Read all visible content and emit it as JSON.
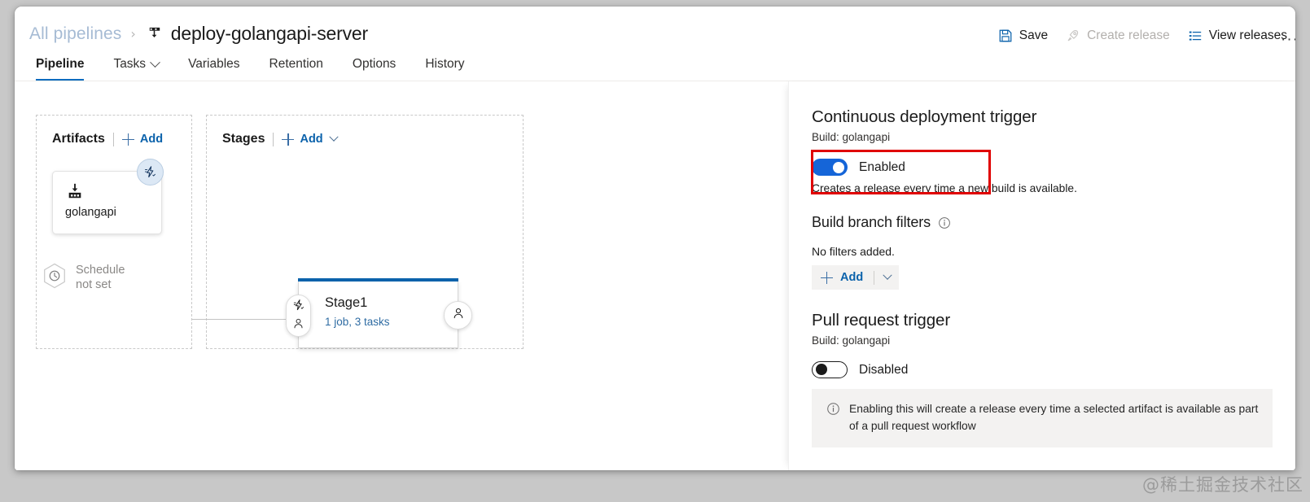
{
  "breadcrumb": {
    "root": "All pipelines",
    "separator": "›",
    "title": "deploy-golangapi-server",
    "icon": "pipeline-icon"
  },
  "toolbar": {
    "items": [
      {
        "label": "Save",
        "icon": "save-icon",
        "disabled": false
      },
      {
        "label": "Create release",
        "icon": "rocket-icon",
        "disabled": true
      },
      {
        "label": "View releases",
        "icon": "list-icon",
        "disabled": false
      }
    ],
    "more_label": "···"
  },
  "tabs": [
    {
      "label": "Pipeline",
      "active": true,
      "caret": false
    },
    {
      "label": "Tasks",
      "active": false,
      "caret": true
    },
    {
      "label": "Variables",
      "active": false,
      "caret": false
    },
    {
      "label": "Retention",
      "active": false,
      "caret": false
    },
    {
      "label": "Options",
      "active": false,
      "caret": false
    },
    {
      "label": "History",
      "active": false,
      "caret": false
    }
  ],
  "canvas": {
    "artifacts": {
      "title": "Artifacts",
      "add_label": "Add",
      "node": {
        "label": "golangapi",
        "icon": "build-artifact-icon",
        "badge_icon": "continuous-deployment-trigger-icon"
      },
      "schedule": {
        "line1": "Schedule",
        "line2": "not set",
        "icon": "clock-icon"
      }
    },
    "stages": {
      "title": "Stages",
      "add_label": "Add",
      "stage": {
        "name": "Stage1",
        "summary": "1 job, 3 tasks",
        "pre_icons": [
          "pre-deployment-trigger-icon",
          "pre-deployment-approval-icon"
        ],
        "post_icon": "post-deployment-approval-icon"
      }
    }
  },
  "details": {
    "cd_trigger": {
      "title": "Continuous deployment trigger",
      "subtitle": "Build: golangapi",
      "toggle_state": "on",
      "toggle_label": "Enabled",
      "helper": "Creates a release every time a new build is available.",
      "highlight_color": "#e00000"
    },
    "branch_filters": {
      "title": "Build branch filters",
      "info_icon": "info-icon",
      "empty_text": "No filters added.",
      "add_label": "Add"
    },
    "pr_trigger": {
      "title": "Pull request trigger",
      "subtitle": "Build: golangapi",
      "toggle_state": "off",
      "toggle_label": "Disabled",
      "info_icon": "info-icon",
      "info_text": "Enabling this will create a release every time a selected artifact is available as part of a pull request workflow"
    }
  },
  "watermark": "@稀土掘金技术社区",
  "colors": {
    "accent": "#0b62ab",
    "toggle_on": "#1565d8",
    "link": "#0b62ab",
    "highlight": "#e00000"
  }
}
